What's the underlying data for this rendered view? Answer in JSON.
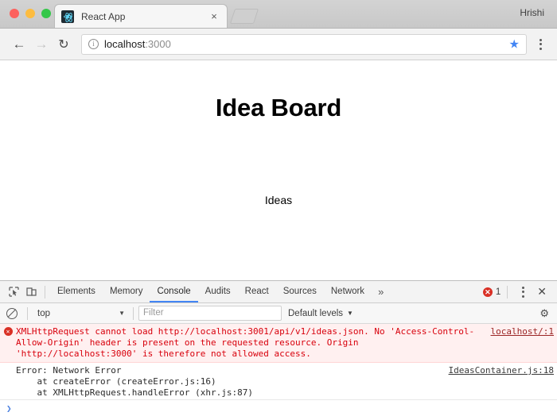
{
  "browser": {
    "profile_name": "Hrishi",
    "tab": {
      "title": "React App",
      "favicon": "react-logo-icon",
      "close_label": "×"
    },
    "newtab_label": "+",
    "nav": {
      "back": "←",
      "forward": "→",
      "reload": "↻",
      "menu": "kebab-menu-icon"
    },
    "omnibox": {
      "info_icon": "ⓘ",
      "host": "localhost",
      "port": ":3000",
      "bookmark_star": "★"
    }
  },
  "page": {
    "heading": "Idea Board",
    "subheading": "Ideas"
  },
  "devtools": {
    "toolbar": {
      "inspect_icon": "inspect-element-icon",
      "device_icon": "device-toolbar-icon",
      "overflow": "»",
      "error_count": "1",
      "error_mark": "✕",
      "menu_icon": "kebab-menu-icon",
      "close_icon": "✕"
    },
    "tabs": [
      {
        "label": "Elements",
        "active": false
      },
      {
        "label": "Memory",
        "active": false
      },
      {
        "label": "Console",
        "active": true
      },
      {
        "label": "Audits",
        "active": false
      },
      {
        "label": "React",
        "active": false
      },
      {
        "label": "Sources",
        "active": false
      },
      {
        "label": "Network",
        "active": false
      }
    ],
    "filterbar": {
      "clear_icon": "clear-console-icon",
      "context": "top",
      "context_caret": "▼",
      "filter_placeholder": "Filter",
      "levels": "Default levels",
      "levels_caret": "▼",
      "settings_icon": "⚙"
    },
    "messages": [
      {
        "type": "error",
        "icon": "✕",
        "text": "XMLHttpRequest cannot load http://localhost:3001/api/v1/ideas.json. No 'Access-Control-Allow-Origin' header is present on the requested resource. Origin 'http://localhost:3000' is therefore not allowed access.",
        "link": "localhost/:1"
      },
      {
        "type": "plain",
        "text": "Error: Network Error\n    at createError (createError.js:16)\n    at XMLHttpRequest.handleError (xhr.js:87)",
        "link": "IdeasContainer.js:18"
      }
    ],
    "prompt_caret": "❯"
  },
  "colors": {
    "accent_blue": "#4285f4",
    "error_red": "#d93025",
    "error_text": "#d8000c",
    "error_bg": "#fff0f0",
    "react_cyan": "#61dafb"
  }
}
